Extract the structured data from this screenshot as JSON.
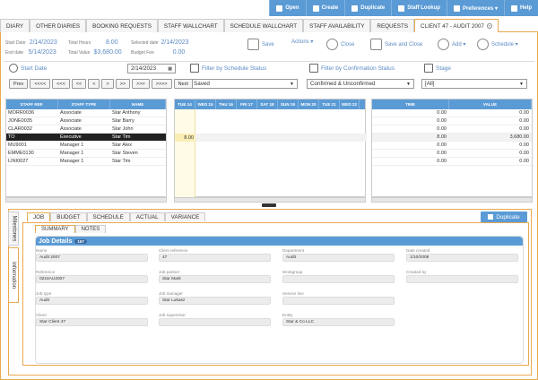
{
  "topbar": {
    "buttons": [
      {
        "label": "Open",
        "icon": "open-icon"
      },
      {
        "label": "Create",
        "icon": "create-icon"
      },
      {
        "label": "Duplicate",
        "icon": "duplicate-icon"
      },
      {
        "label": "Staff Lookup",
        "icon": "staff-lookup-icon"
      },
      {
        "label": "Preferences ▾",
        "icon": "preferences-icon"
      },
      {
        "label": "Help",
        "icon": "help-icon"
      }
    ]
  },
  "tabs": [
    "DIARY",
    "OTHER DIARIES",
    "BOOKING REQUESTS",
    "STAFF WALLCHART",
    "SCHEDULE WALLCHART",
    "STAFF AVAILABILITY",
    "REQUESTS",
    "CLIENT 47 - AUDIT 2007"
  ],
  "info": {
    "start_date_label": "Start Date",
    "start_date": "2/14/2023",
    "end_date_label": "End date",
    "end_date": "5/14/2023",
    "total_hours_label": "Total Hours",
    "total_hours": "8.00",
    "total_value_label": "Total Value",
    "total_value": "$3,680.00",
    "selected_date_label": "Selected date",
    "selected_date": "2/14/2023",
    "budget_fee_label": "Budget Fee",
    "budget_fee": "0.00"
  },
  "toolbar": {
    "save": "Save",
    "actions": "Actions ▾",
    "close": "Close",
    "save_close": "Save and Close",
    "add": "Add ▾",
    "schedule": "Schedule ▾"
  },
  "filters": {
    "start_date_label": "Start Date",
    "start_date_value": "2/14/2023",
    "schedule_status_label": "Filter by Schedule Status",
    "schedule_status_value": "Saved",
    "confirmation_label": "Filter by Confirmation Status",
    "confirmation_value": "Confirmed & Unconfirmed",
    "stage_label": "Stage",
    "stage_value": "[All]"
  },
  "nav": [
    "Prev",
    "<<<<",
    "<<<",
    "<<",
    "<",
    ">",
    ">>",
    ">>>",
    ">>>>",
    "Next"
  ],
  "staff_grid": {
    "headers": [
      "STAFF REF.",
      "STAFF TYPE",
      "NAME"
    ],
    "rows": [
      [
        "MORR0036",
        "Associate",
        "Star Anthony"
      ],
      [
        "JONE0035",
        "Associate",
        "Star Barry"
      ],
      [
        "CLAR0032",
        "Associate",
        "Star John"
      ],
      [
        "TO",
        "Executive",
        "Star Tim"
      ],
      [
        "MU9001",
        "Manager 1",
        "Star Alex"
      ],
      [
        "EMME0130",
        "Manager 1",
        "Star Steven"
      ],
      [
        "LINI0027",
        "Manager 1",
        "Star Tim"
      ]
    ],
    "selected_index": 3
  },
  "day_grid": {
    "headers": [
      "TUE 14",
      "WED 15",
      "THU 16",
      "FRI 17",
      "SAT 18",
      "SUN 19",
      "MON 20",
      "TUE 21",
      "WED 22"
    ],
    "selected_value": "8.00"
  },
  "value_grid": {
    "headers": [
      "TIME",
      "VALUE"
    ],
    "rows": [
      [
        "0.00",
        "0.00"
      ],
      [
        "0.00",
        "0.00"
      ],
      [
        "0.00",
        "0.00"
      ],
      [
        "8.00",
        "3,680.00"
      ],
      [
        "0.00",
        "0.00"
      ],
      [
        "0.00",
        "0.00"
      ],
      [
        "0.00",
        "0.00"
      ]
    ]
  },
  "side_tabs": [
    "Milestones",
    "Information"
  ],
  "sub_tabs": [
    "JOB",
    "BUDGET",
    "SCHEDULE",
    "ACTUAL",
    "VARIANCE"
  ],
  "duplicate_btn": "Duplicate",
  "sub2_tabs": [
    "SUMMARY",
    "NOTES"
  ],
  "job_details": {
    "title": "Job Details",
    "badge": "167",
    "fields": [
      {
        "label": "Name",
        "value": "Audit 2007"
      },
      {
        "label": "Client reference",
        "value": "47"
      },
      {
        "label": "Department",
        "value": "Audit"
      },
      {
        "label": "Date created",
        "value": "1/10/2008"
      },
      {
        "label": "Reference",
        "value": "0224AU2007"
      },
      {
        "label": "Job partner",
        "value": "Star Mark"
      },
      {
        "label": "Workgroup",
        "value": ""
      },
      {
        "label": "Created by",
        "value": ""
      },
      {
        "label": "Job type",
        "value": "Audit"
      },
      {
        "label": "Job manager",
        "value": "Star Lukasz"
      },
      {
        "label": "Service line",
        "value": ""
      },
      {
        "label": "Client",
        "value": "Star Client 47"
      },
      {
        "label": "Job supervisor",
        "value": ""
      },
      {
        "label": "Entity",
        "value": "Star & Co LLC"
      }
    ]
  }
}
